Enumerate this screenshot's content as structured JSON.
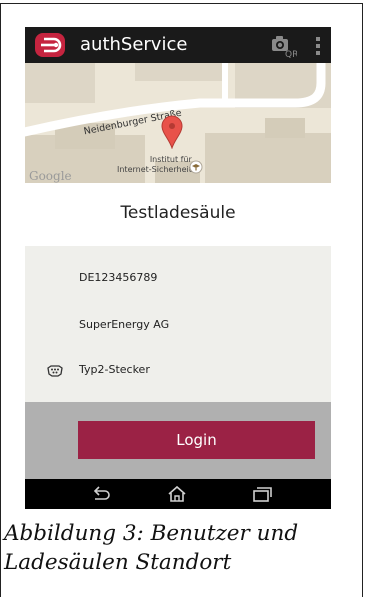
{
  "app": {
    "title": "authService",
    "accent_color": "#c5243f",
    "actionbar_color": "#1a1a1a"
  },
  "icons": {
    "logo": "app-logo-icon",
    "qr_camera": "qr-camera-icon",
    "overflow": "overflow-menu-icon",
    "plug": "plug-icon",
    "back": "back-icon",
    "home": "home-icon",
    "recents": "recents-icon"
  },
  "qr_badge": "QR",
  "map": {
    "street": "Neidenburger Straße",
    "poi_line1": "Institut für",
    "poi_line2": "Internet-Sicherheit",
    "attribution": "Google"
  },
  "station": {
    "name": "Testladesäule",
    "id": "DE123456789",
    "operator": "SuperEnergy AG",
    "plug_type": "Typ2-Stecker"
  },
  "actions": {
    "login_label": "Login",
    "login_color": "#9b2245"
  },
  "caption": {
    "line1": "Abbildung 3: Benutzer und",
    "line2": "Ladesäulen Standort"
  }
}
